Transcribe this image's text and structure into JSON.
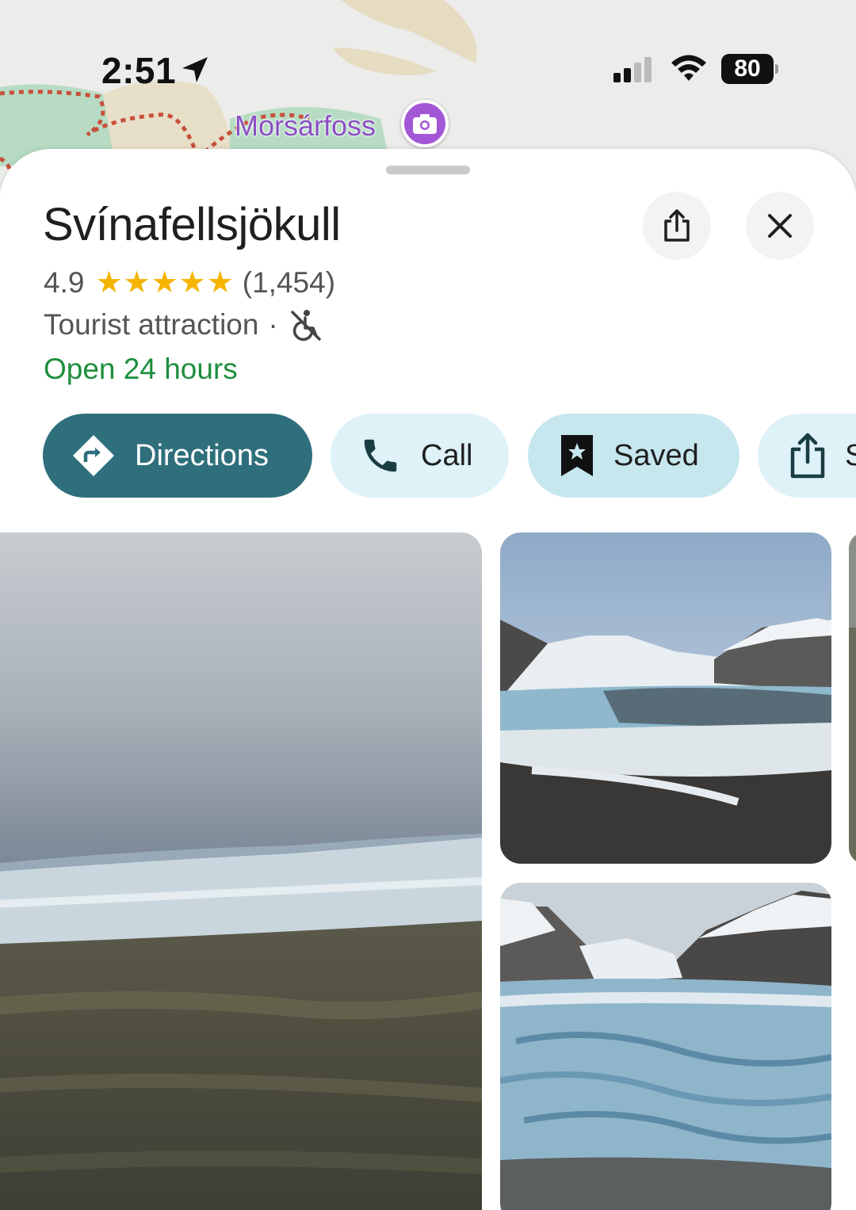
{
  "status_bar": {
    "time": "2:51",
    "battery": "80"
  },
  "map": {
    "label": "Morsárfoss"
  },
  "place": {
    "name": "Svínafellsjökull",
    "rating": "4.9",
    "stars": "★★★★★",
    "review_count": "(1,454)",
    "category": "Tourist attraction",
    "separator": "·",
    "hours": "Open 24 hours"
  },
  "actions": {
    "directions": "Directions",
    "call": "Call",
    "saved": "Saved",
    "share": "S"
  },
  "colors": {
    "open_green": "#1e8e3e",
    "directions_bg": "#2f6f7c",
    "chip_bg": "#def2f8",
    "saved_bg": "#c7e7ef",
    "star": "#f5b400",
    "map_label": "#8b4fc4"
  },
  "icons": {
    "location": "location-arrow-icon",
    "signal": "cellular-signal-icon",
    "wifi": "wifi-icon",
    "photo_pin": "camera-pin-icon",
    "share": "share-icon",
    "close": "close-icon",
    "wheelchair": "no-wheelchair-access-icon",
    "directions": "directions-icon",
    "call": "phone-icon",
    "saved": "bookmark-icon"
  }
}
